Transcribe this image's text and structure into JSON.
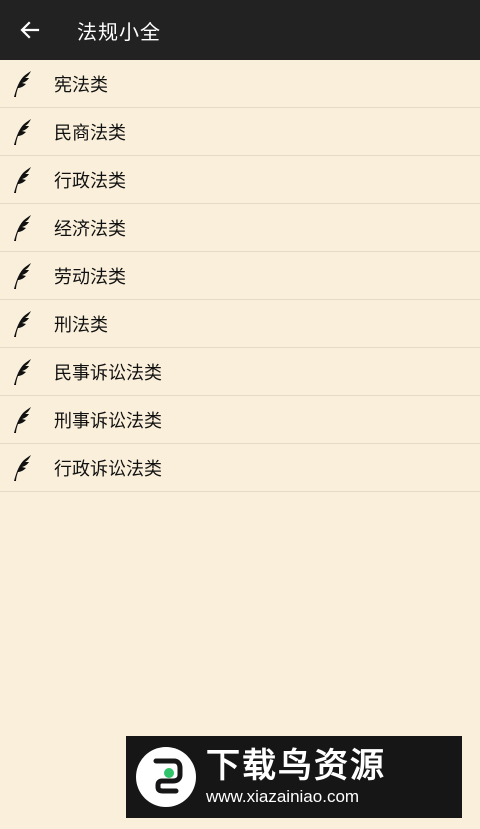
{
  "appbar": {
    "title": "法规小全",
    "back_icon": "arrow-left-icon"
  },
  "list": {
    "item_icon": "quill-feather-icon",
    "items": [
      {
        "label": "宪法类"
      },
      {
        "label": "民商法类"
      },
      {
        "label": "行政法类"
      },
      {
        "label": "经济法类"
      },
      {
        "label": "劳动法类"
      },
      {
        "label": "刑法类"
      },
      {
        "label": "民事诉讼法类"
      },
      {
        "label": "刑事诉讼法类"
      },
      {
        "label": "行政诉讼法类"
      }
    ]
  },
  "watermark": {
    "title": "下载鸟资源",
    "url": "www.xiazainiao.com"
  },
  "colors": {
    "appbar_bg": "#222222",
    "page_bg": "#faefdb",
    "divider": "#e6dac4",
    "watermark_accent": "#2fc46a"
  }
}
